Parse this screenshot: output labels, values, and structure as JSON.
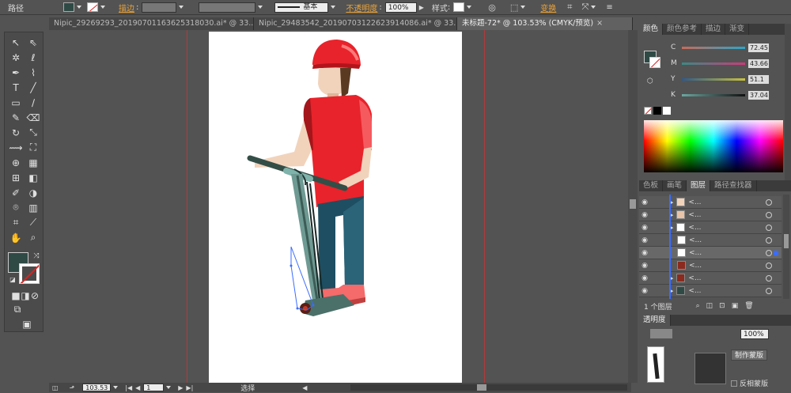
{
  "control_bar": {
    "selection_label": "路径",
    "stroke_label": "描边",
    "stroke_style": "基本",
    "opacity_label": "不透明度",
    "opacity_value": "100%",
    "style_label": "样式",
    "transform_label": "变换"
  },
  "tabs": [
    {
      "label": "Nipic_29269293_20190701163625318030.ai* @ 33...",
      "active": false
    },
    {
      "label": "Nipic_29483542_20190703122623914086.ai* @ 33...",
      "active": false
    },
    {
      "label": "未标题-72* @ 103.53% (CMYK/预览)",
      "active": true
    }
  ],
  "tab_close": "×",
  "statusbar": {
    "zoom": "103.53",
    "page": "1",
    "tool_status": "选择"
  },
  "color_panel": {
    "tabs": [
      "颜色",
      "颜色参考",
      "描边",
      "渐变"
    ],
    "channels": [
      {
        "label": "C",
        "value": "72.45",
        "color": "#2aa5c8"
      },
      {
        "label": "M",
        "value": "43.66",
        "color": "#cc3a7a"
      },
      {
        "label": "Y",
        "value": "51.1",
        "color": "#c9c23b"
      },
      {
        "label": "K",
        "value": "37.04",
        "color": "#777777"
      }
    ]
  },
  "layers_panel": {
    "tabs": [
      "色板",
      "画笔",
      "图层",
      "路径查找器"
    ],
    "rows": [
      "<...",
      "<...",
      "<...",
      "<...",
      "<...",
      "<...",
      "<...",
      "<..."
    ],
    "footer_count": "1 个图层"
  },
  "transparency_panel": {
    "title": "透明度",
    "opacity_value": "100%",
    "clip_btn": "制作蒙版",
    "invert_label": "反相蒙版"
  },
  "colors": {
    "fill_color": "#2f4a45",
    "guide_red": "#b23a3a"
  }
}
